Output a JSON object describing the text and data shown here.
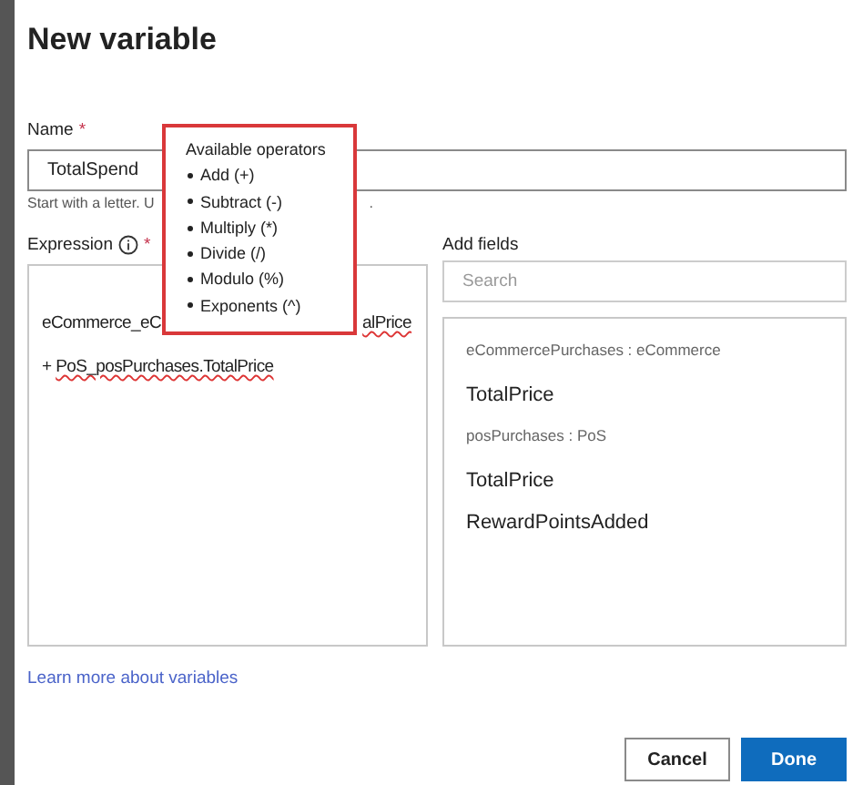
{
  "dialog": {
    "title": "New variable"
  },
  "name_field": {
    "label": "Name",
    "required_mark": "*",
    "value": "TotalSpend",
    "hint_start": "Start with a letter. U",
    "hint_end": "."
  },
  "expression": {
    "label": "Expression",
    "required_mark": "*",
    "line_1_start": "eCommerce_eC",
    "line_1_end": "alPrice",
    "line_2_operator": "+",
    "line_2": "PoS_posPurchases.TotalPrice"
  },
  "operators_popup": {
    "title": "Available operators",
    "items": [
      "Add (+)",
      "Subtract (-)",
      "Multiply (*)",
      "Divide (/)",
      "Modulo (%)",
      "Exponents (^)"
    ]
  },
  "add_fields": {
    "label": "Add fields",
    "search": {
      "placeholder": "Search"
    },
    "groups": [
      {
        "heading": "eCommercePurchases : eCommerce",
        "fields": [
          "TotalPrice"
        ]
      },
      {
        "heading": "posPurchases : PoS",
        "fields": [
          "TotalPrice",
          "RewardPointsAdded"
        ]
      }
    ]
  },
  "link": "Learn more about variables",
  "buttons": [
    {
      "label": "Cancel",
      "kind": "secondary"
    },
    {
      "label": "Done",
      "kind": "primary"
    }
  ]
}
